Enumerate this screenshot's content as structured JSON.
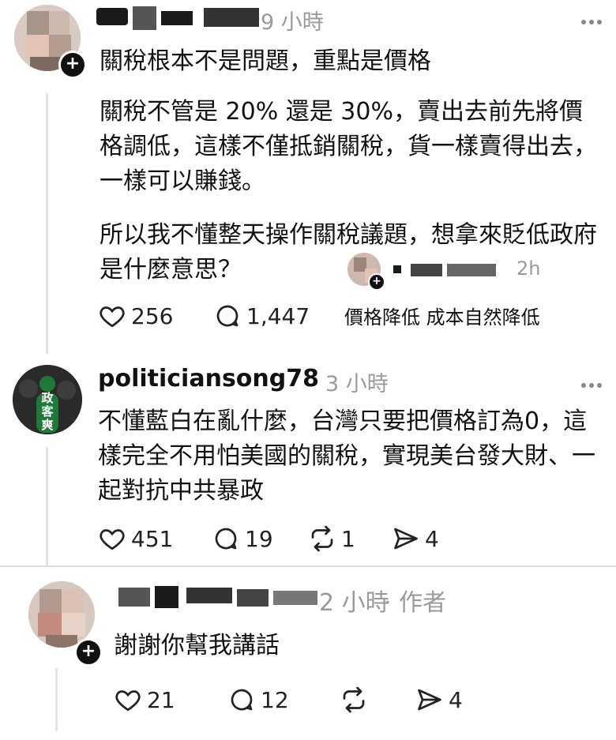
{
  "post1": {
    "time": "9 小時",
    "title": "關稅根本不是問題，重點是價格",
    "para1": "關稅不管是 20% 還是 30%，賣出去前先將價格調低，這樣不僅抵銷關稅，貨一樣賣得出去，一樣可以賺錢。",
    "para2": "所以我不懂整天操作關稅議題，想拿來貶低政府是什麼意思？",
    "likes": "256",
    "comments": "1,447",
    "popup_time": "2h",
    "popup_text": "價格降低 成本自然降低"
  },
  "post2": {
    "username": "politiciansong78",
    "time": "3 小時",
    "avatar_text": "政客爽",
    "text": "不懂藍白在亂什麼，台灣只要把價格訂為0，這樣完全不用怕美國的關稅，實現美台發大財、一起對抗中共暴政",
    "likes": "451",
    "comments": "19",
    "reposts": "1",
    "shares": "4"
  },
  "post3": {
    "time": "2 小時",
    "author_tag": "· 作者",
    "text": "謝謝你幫我講話",
    "likes": "21",
    "comments": "12",
    "shares": "4"
  },
  "colors": {
    "text": "#111111",
    "meta": "#9a9a9a",
    "avatar_green": "#1f7a3a"
  }
}
